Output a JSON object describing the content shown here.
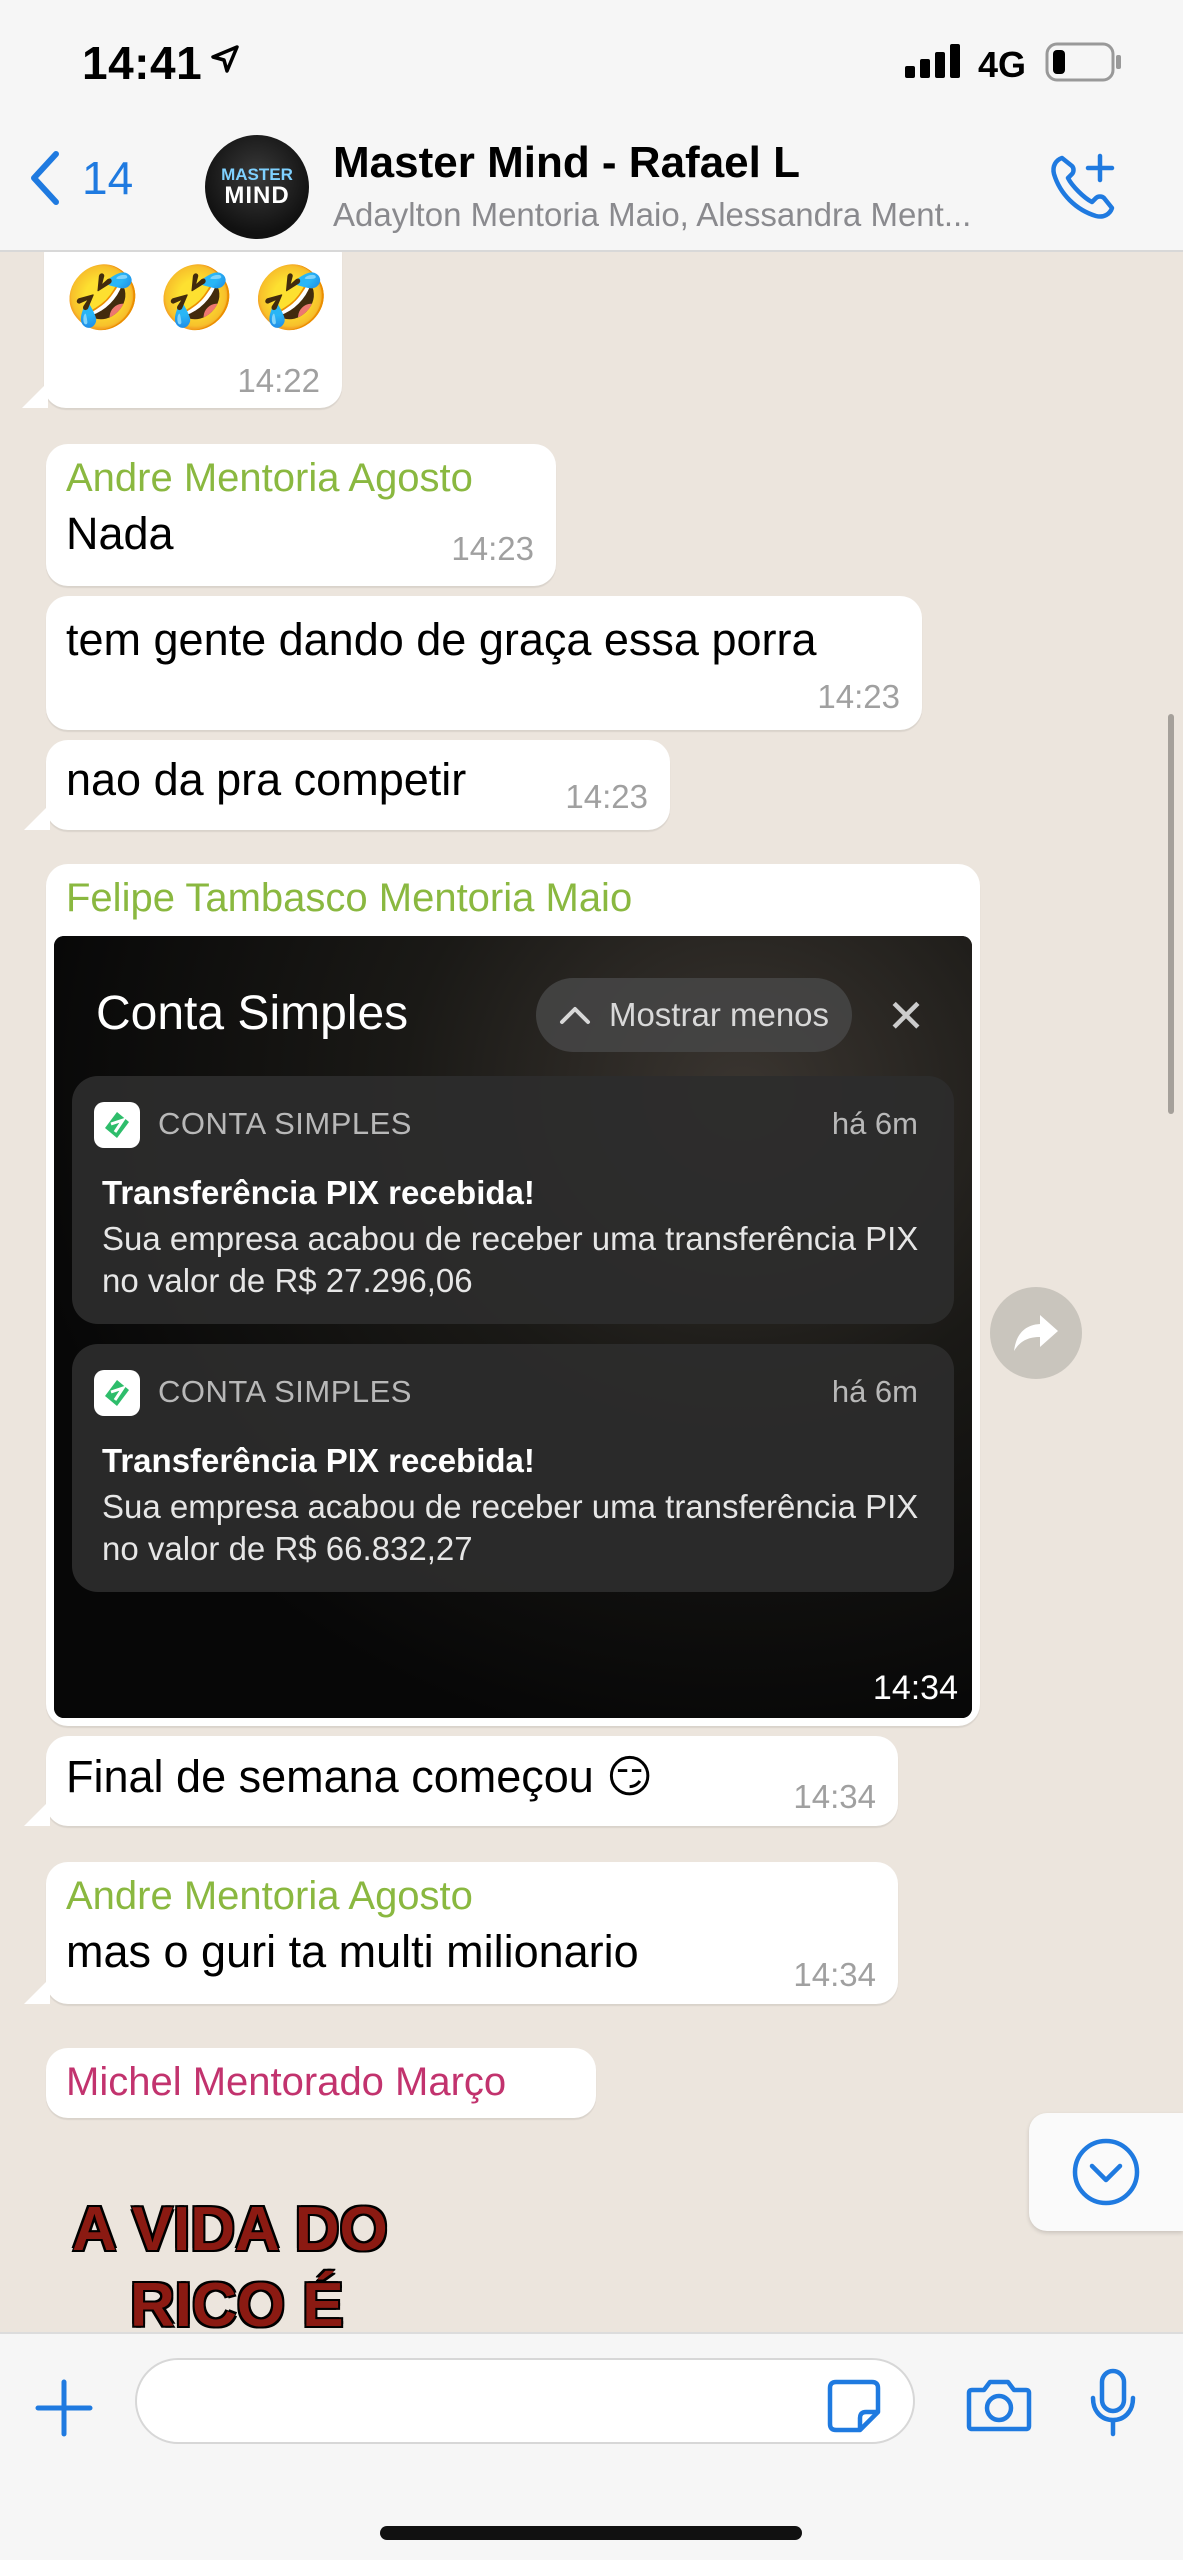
{
  "status_bar": {
    "time": "14:41",
    "network": "4G"
  },
  "header": {
    "back_count": "14",
    "avatar_text_top": "MASTER",
    "avatar_text_main": "MIND",
    "title": "Master Mind - Rafael L",
    "subtitle": "Adaylton Mentoria Maio, Alessandra Ment..."
  },
  "messages": [
    {
      "type": "emoji",
      "text": "🤣 🤣 🤣",
      "time": "14:22"
    },
    {
      "sender": "Andre Mentoria Agosto",
      "sender_color": "#8ab840",
      "text": "Nada",
      "time": "14:23"
    },
    {
      "text": "tem gente dando de graça essa porra",
      "time": "14:23"
    },
    {
      "text": "nao da pra competir",
      "time": "14:23"
    },
    {
      "sender": "Felipe Tambasco Mentoria Maio",
      "sender_color": "#8ab840",
      "type": "image",
      "time": "14:34"
    },
    {
      "text": "Final de semana começou 😏",
      "time": "14:34"
    },
    {
      "sender": "Andre Mentoria Agosto",
      "sender_color": "#8ab840",
      "text": "mas o guri ta multi milionario",
      "time": "14:34"
    },
    {
      "sender": "Michel Mentorado Março",
      "sender_color": "#c2336e",
      "type": "sticker"
    }
  ],
  "image_content": {
    "app_title": "Conta Simples",
    "show_less": "Mostrar menos",
    "notifications": [
      {
        "app": "CONTA SIMPLES",
        "age": "há 6m",
        "title": "Transferência PIX recebida!",
        "body": "Sua empresa acabou de receber uma transferência PIX no valor de R$ 27.296,06"
      },
      {
        "app": "CONTA SIMPLES",
        "age": "há 6m",
        "title": "Transferência PIX recebida!",
        "body": "Sua empresa acabou de receber uma transferência PIX no valor de R$ 66.832,27"
      }
    ]
  },
  "sticker": {
    "line1": "A VIDA DO",
    "line2": "RICO É"
  },
  "icons": {
    "back": "chevron-left-icon",
    "call": "phone-plus-icon",
    "forward": "forward-icon",
    "scroll_down": "chevron-down-circle-icon",
    "plus": "plus-icon",
    "sticker": "sticker-icon",
    "camera": "camera-icon",
    "mic": "microphone-icon"
  },
  "colors": {
    "accent": "#1f7ae0",
    "sender_green": "#8ab840",
    "sender_pink": "#c2336e",
    "chat_bg": "#ece5dd"
  }
}
